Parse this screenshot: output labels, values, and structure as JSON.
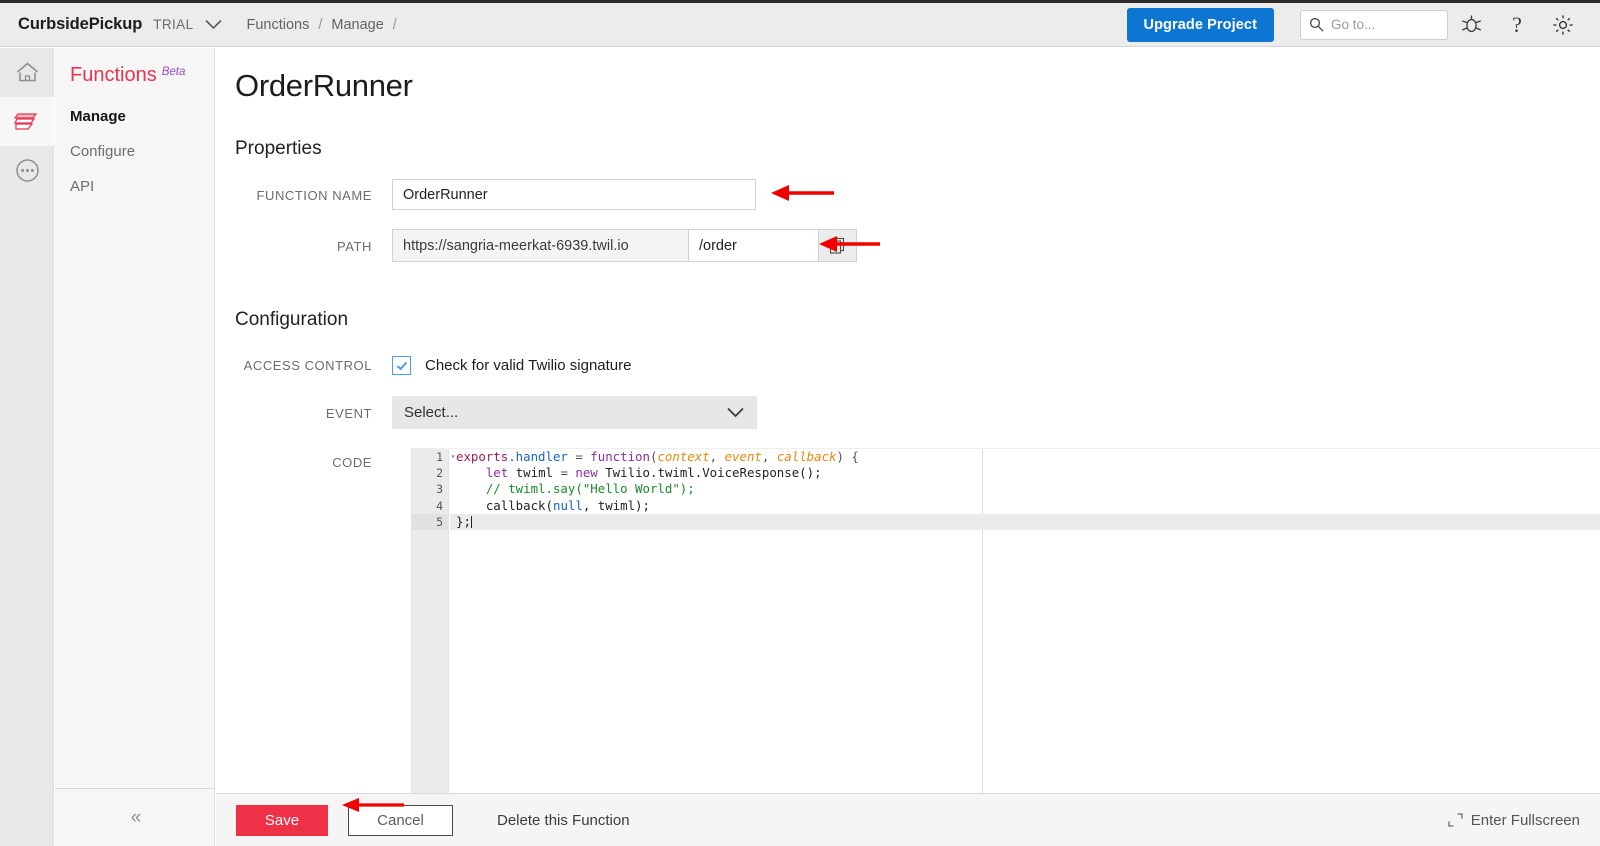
{
  "header": {
    "brand": "CurbsidePickup",
    "plan_badge": "TRIAL",
    "breadcrumbs": [
      "Functions",
      "Manage"
    ],
    "separator": "/",
    "upgrade_label": "Upgrade Project",
    "search_placeholder": "Go to...",
    "icons": [
      "search-icon",
      "bug-icon",
      "help-icon",
      "gear-icon"
    ]
  },
  "rail": {
    "items": [
      {
        "name": "home-icon"
      },
      {
        "name": "functions-icon"
      },
      {
        "name": "more-icon"
      }
    ]
  },
  "sidebar": {
    "title": "Functions",
    "badge": "Beta",
    "items": [
      {
        "label": "Manage",
        "selected": true
      },
      {
        "label": "Configure",
        "selected": false
      },
      {
        "label": "API",
        "selected": false
      }
    ],
    "collapse_glyph": "«"
  },
  "page": {
    "title": "OrderRunner"
  },
  "properties": {
    "heading": "Properties",
    "function_name_label": "FUNCTION NAME",
    "function_name_value": "OrderRunner",
    "path_label": "PATH",
    "path_prefix": "https://sangria-meerkat-6939.twil.io",
    "path_suffix": "/order",
    "copy_icon": "copy-icon"
  },
  "configuration": {
    "heading": "Configuration",
    "access_control_label": "ACCESS CONTROL",
    "checkbox_label": "Check for valid Twilio signature",
    "checkbox_checked": true,
    "event_label": "EVENT",
    "event_value": "Select...",
    "code_label": "CODE"
  },
  "editor": {
    "line_numbers": [
      "1",
      "2",
      "3",
      "4",
      "5"
    ],
    "active_line": 5,
    "fold_glyph": "▾",
    "lines": [
      [
        {
          "t": "exports",
          "c": "t-maroon"
        },
        {
          "t": ".handler",
          "c": "t-blue"
        },
        {
          "t": " = ",
          "c": "t-punct"
        },
        {
          "t": "function",
          "c": "t-purple"
        },
        {
          "t": "(",
          "c": "t-punct"
        },
        {
          "t": "context",
          "c": "t-param"
        },
        {
          "t": ", ",
          "c": "t-punct"
        },
        {
          "t": "event",
          "c": "t-param"
        },
        {
          "t": ", ",
          "c": "t-punct"
        },
        {
          "t": "callback",
          "c": "t-param"
        },
        {
          "t": ") {",
          "c": "t-punct"
        }
      ],
      [
        {
          "t": "    ",
          "c": "t-plain"
        },
        {
          "t": "let",
          "c": "t-purple"
        },
        {
          "t": " twiml ",
          "c": "t-plain"
        },
        {
          "t": "= ",
          "c": "t-punct"
        },
        {
          "t": "new",
          "c": "t-purple"
        },
        {
          "t": " Twilio.twiml.VoiceResponse();",
          "c": "t-plain"
        }
      ],
      [
        {
          "t": "    // twiml.say(\"Hello World\");",
          "c": "t-green"
        }
      ],
      [
        {
          "t": "    callback(",
          "c": "t-plain"
        },
        {
          "t": "null",
          "c": "t-blue"
        },
        {
          "t": ", twiml);",
          "c": "t-plain"
        }
      ],
      [
        {
          "t": "};",
          "c": "t-plain"
        }
      ]
    ]
  },
  "actions": {
    "save_label": "Save",
    "cancel_label": "Cancel",
    "delete_label": "Delete this Function",
    "fullscreen_label": "Enter Fullscreen",
    "fullscreen_icon": "fullscreen-icon"
  },
  "colors": {
    "accent_red": "#ef3147",
    "brand_blue": "#0d76d3",
    "functions_red": "#e8344e",
    "beta_purple": "#9b4dca",
    "annotation_red": "#f10000"
  }
}
